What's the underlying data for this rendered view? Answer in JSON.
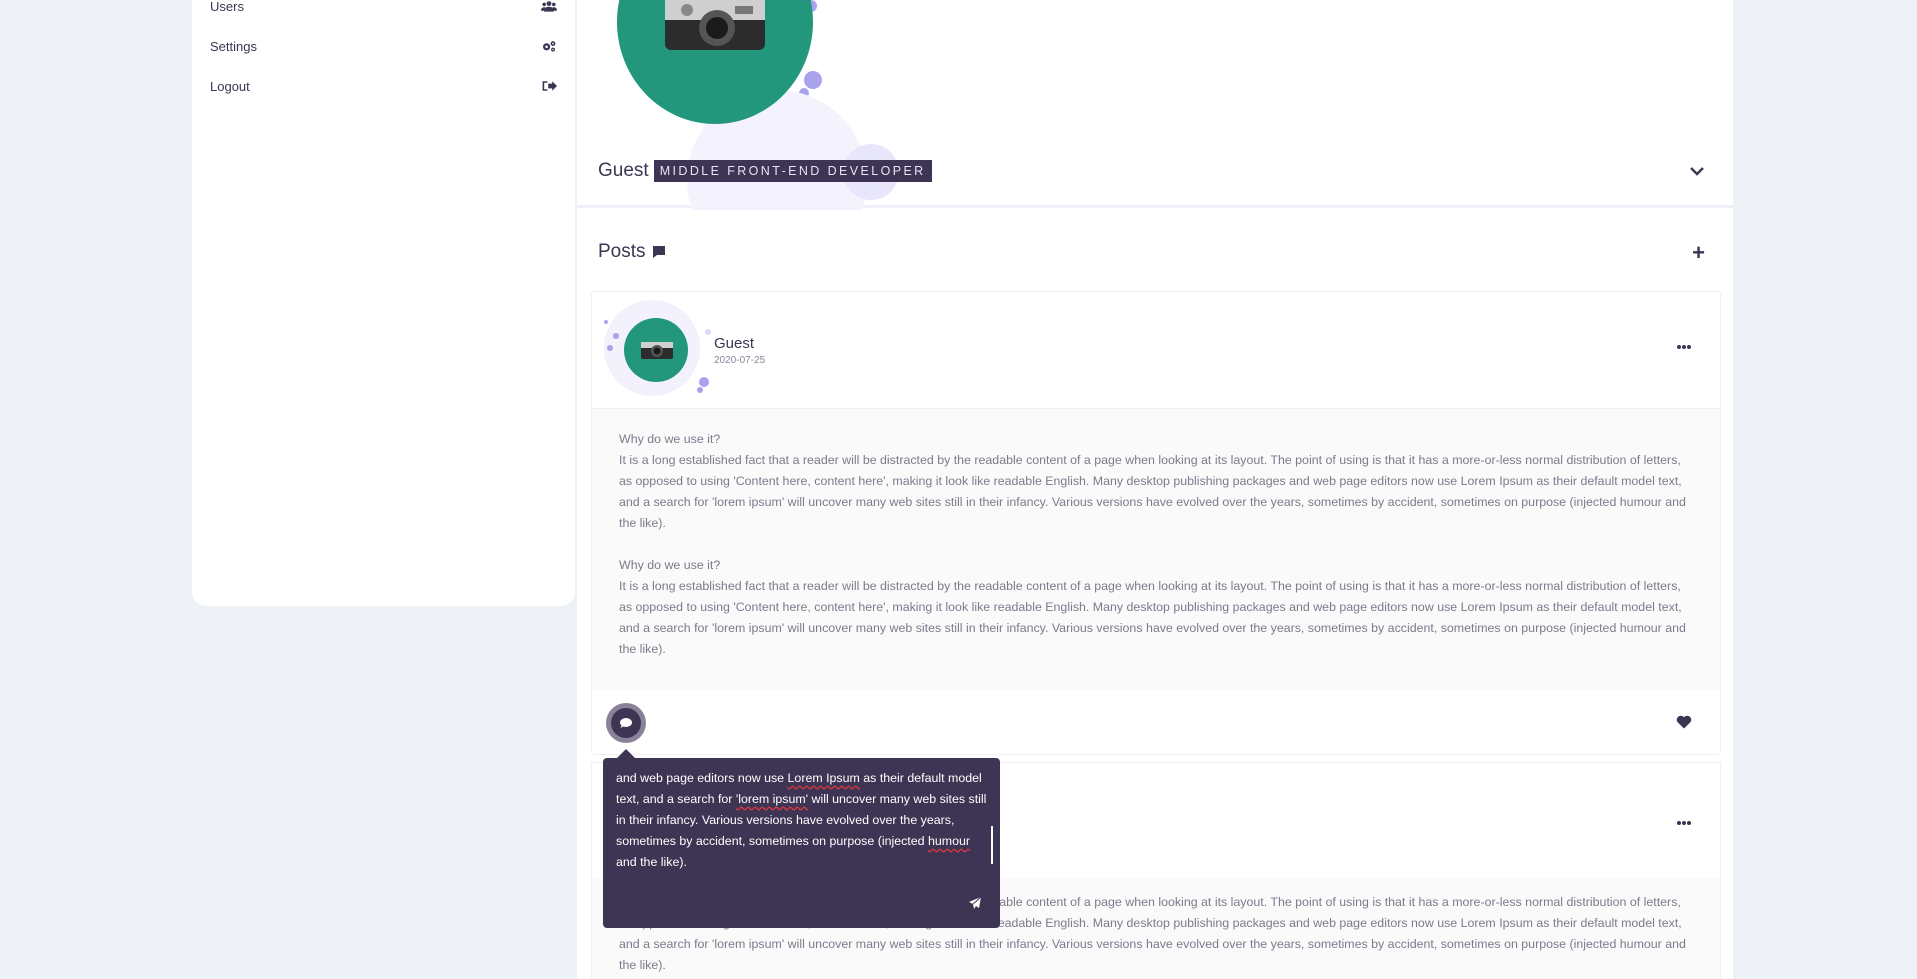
{
  "sidebar": {
    "items": [
      {
        "label": "Users",
        "icon": "users-icon"
      },
      {
        "label": "Settings",
        "icon": "gears-icon"
      },
      {
        "label": "Logout",
        "icon": "logout-icon"
      }
    ]
  },
  "profile": {
    "name": "Guest",
    "role": "MIDDLE FRONT-END DEVELOPER"
  },
  "posts_section": {
    "title": "Posts"
  },
  "post": {
    "author": "Guest",
    "date": "2020-07-25",
    "paragraphs": [
      {
        "heading": "Why do we use it?",
        "text": "It is a long established fact that a reader will be distracted by the readable content of a page when looking at its layout. The point of using is that it has a more-or-less normal distribution of letters, as opposed to using 'Content here, content here', making it look like readable English. Many desktop publishing packages and web page editors now use Lorem Ipsum as their default model text, and a search for 'lorem ipsum' will uncover many web sites still in their infancy. Various versions have evolved over the years, sometimes by accident, sometimes on purpose (injected humour and the like)."
      },
      {
        "heading": "Why do we use it?",
        "text": "It is a long established fact that a reader will be distracted by the readable content of a page when looking at its layout. The point of using is that it has a more-or-less normal distribution of letters, as opposed to using 'Content here, content here', making it look like readable English. Many desktop publishing packages and web page editors now use Lorem Ipsum as their default model text, and a search for 'lorem ipsum' will uncover many web sites still in their infancy. Various versions have evolved over the years, sometimes by accident, sometimes on purpose (injected humour and the like)."
      }
    ]
  },
  "post2": {
    "text": "It is a long established fact that a reader will be distracted by the readable content of a page when looking at its layout. The point of using is that it has a more-or-less normal distribution of letters, as opposed to using 'Content here, content here', making it look like readable English. Many desktop publishing packages and web page editors now use Lorem Ipsum as their default model text, and a search for 'lorem ipsum' will uncover many web sites still in their infancy. Various versions have evolved over the years, sometimes by accident, sometimes on purpose (injected humour and the like)."
  },
  "comment": {
    "parts": [
      "and web page editors now use ",
      "Lorem Ipsum",
      " as their default model text, and a search for ",
      "'lorem ipsum'",
      " will uncover many web sites still in their infancy. Various versions have evolved over the years, sometimes by accident, sometimes on purpose (injected ",
      "humour",
      " and the like)."
    ]
  },
  "colors": {
    "primary": "#3d3553",
    "accent_green": "#22977c",
    "accent_lilac": "#a9a3ee",
    "background": "#eef2f7"
  }
}
